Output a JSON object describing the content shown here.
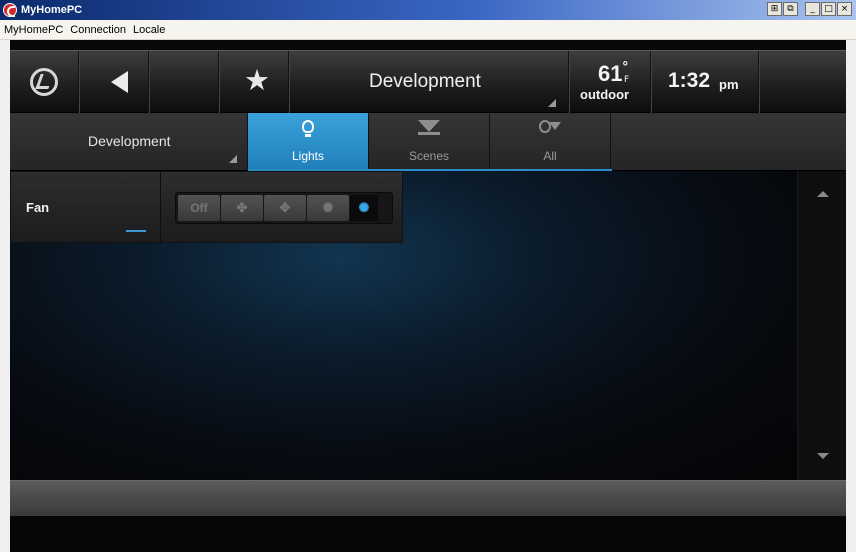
{
  "window": {
    "title": "MyHomePC",
    "controls": [
      "⊞",
      "⧉",
      "_",
      "□",
      "×"
    ]
  },
  "menu": {
    "items": [
      "MyHomePC",
      "Connection",
      "Locale"
    ]
  },
  "topbar": {
    "room_title": "Development",
    "temperature": "61",
    "temperature_degree": "°",
    "temperature_unit": "F",
    "temperature_label": "outdoor",
    "time": "1:32",
    "time_ampm": "pm",
    "icons": [
      "logo-icon",
      "back-icon",
      "star-icon"
    ]
  },
  "tabs": {
    "room_select": "Development",
    "items": [
      {
        "label": "Lights",
        "icon": "bulb-icon",
        "active": true
      },
      {
        "label": "Scenes",
        "icon": "scenes-icon",
        "active": false
      },
      {
        "label": "All",
        "icon": "all-icon",
        "active": false
      }
    ]
  },
  "device": {
    "name": "Fan",
    "fan_speeds": [
      "Off",
      "low",
      "medium",
      "high",
      "max"
    ],
    "fan_off_label": "Off",
    "selected_speed": "max"
  },
  "colors": {
    "accent": "#2c8ac6",
    "active_tab": "#3aa2da",
    "fan_active": "#35a7ea"
  }
}
